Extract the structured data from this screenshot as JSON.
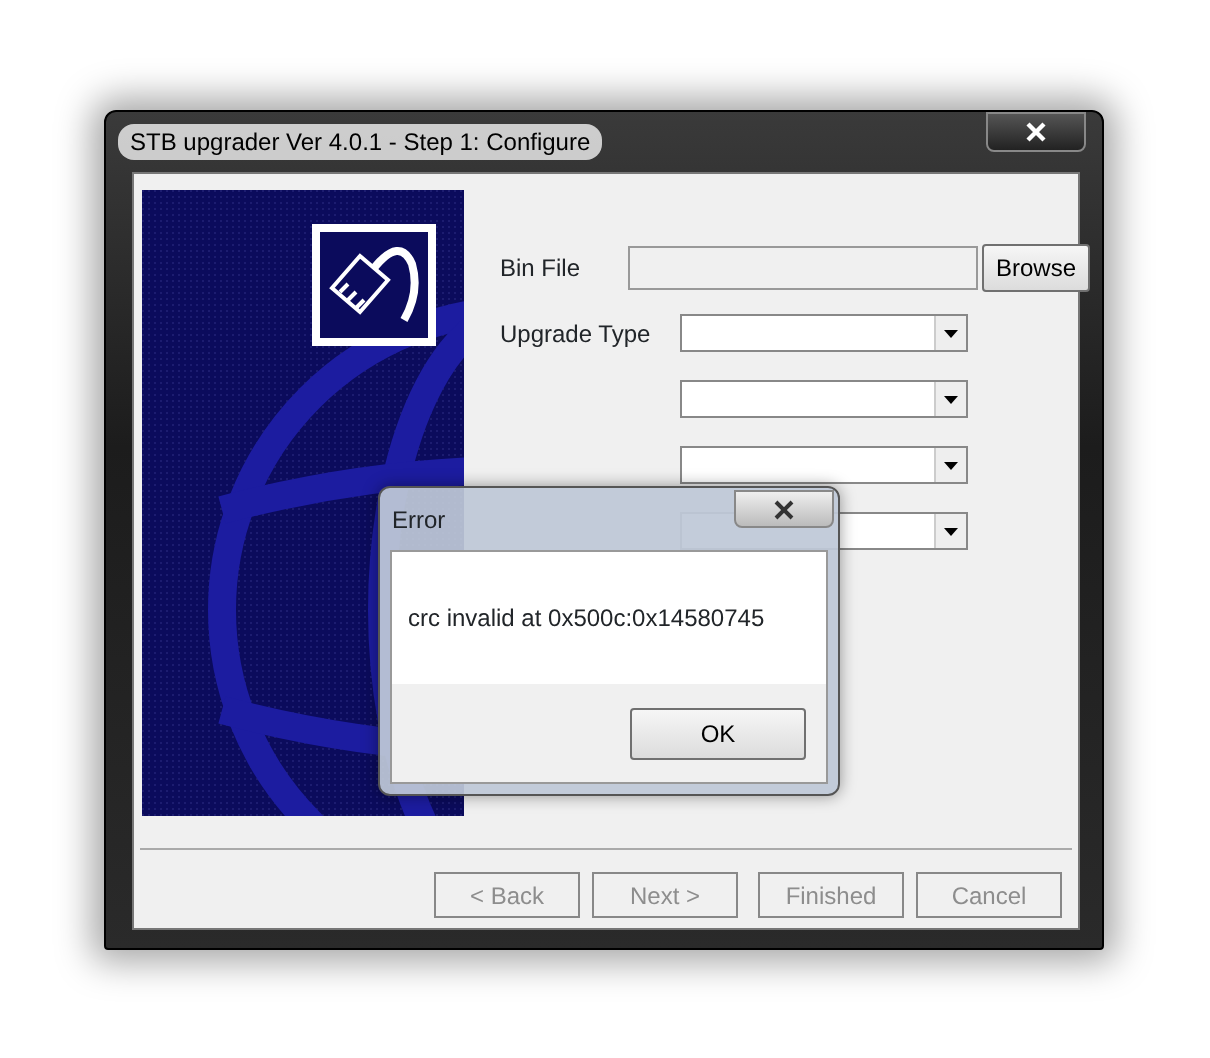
{
  "window": {
    "title": "STB upgrader Ver 4.0.1 - Step 1: Configure"
  },
  "fields": [
    {
      "kind": "text",
      "label": "Bin File",
      "button": "Browse"
    },
    {
      "kind": "select",
      "label": "Upgrade Type"
    },
    {
      "kind": "select"
    },
    {
      "kind": "select"
    },
    {
      "kind": "select"
    }
  ],
  "wizard_buttons": [
    {
      "label": "< Back",
      "disabled": true
    },
    {
      "label": "Next >",
      "disabled": true
    },
    {
      "label": "Finished",
      "disabled": true
    },
    {
      "label": "Cancel",
      "disabled": true
    }
  ],
  "dialog": {
    "title": "Error",
    "message": "crc invalid at 0x500c:0x14580745",
    "button": "OK"
  }
}
